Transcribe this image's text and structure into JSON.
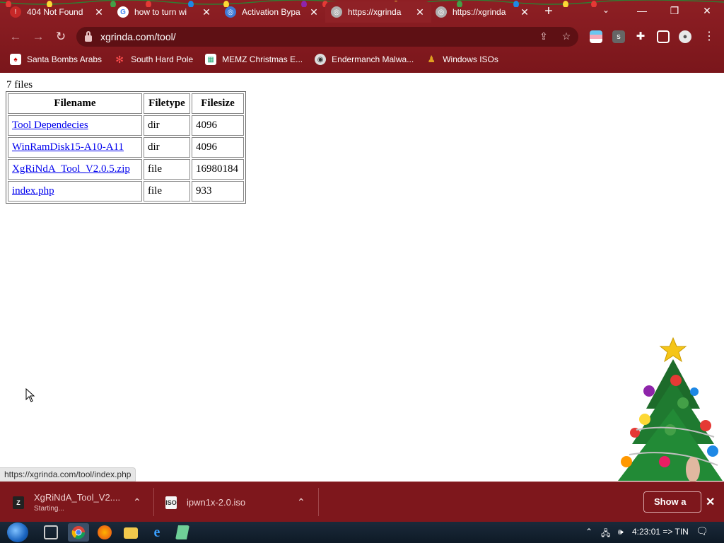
{
  "tabs": [
    {
      "title": "404 Not Found",
      "favicon": "error-favicon",
      "active": false
    },
    {
      "title": "how to turn wi",
      "favicon": "google-favicon",
      "active": false
    },
    {
      "title": "Activation Bypa",
      "favicon": "globe-favicon",
      "active": false
    },
    {
      "title": "https://xgrinda",
      "favicon": "globe-favicon",
      "active": true
    },
    {
      "title": "https://xgrinda",
      "favicon": "globe-favicon",
      "active": false
    }
  ],
  "address": {
    "url": "xgrinda.com/tool/"
  },
  "bookmarks": [
    {
      "label": "Santa Bombs Arabs",
      "icon": "santa-icon"
    },
    {
      "label": "South Hard Pole",
      "icon": "snowflake-icon"
    },
    {
      "label": "MEMZ Christmas E...",
      "icon": "gift-icon"
    },
    {
      "label": "Endermanch Malwa...",
      "icon": "raccoon-icon"
    },
    {
      "label": "Windows ISOs",
      "icon": "folder-icon"
    }
  ],
  "listing": {
    "count_label": "7 files",
    "headers": [
      "Filename",
      "Filetype",
      "Filesize"
    ],
    "rows": [
      {
        "name": "Tool Dependecies",
        "type": "dir",
        "size": "4096"
      },
      {
        "name": "WinRamDisk15-A10-A11",
        "type": "dir",
        "size": "4096"
      },
      {
        "name": "XgRiNdA_Tool_V2.0.5.zip",
        "type": "file",
        "size": "16980184"
      },
      {
        "name": "index.php",
        "type": "file",
        "size": "933"
      }
    ]
  },
  "statusbar": {
    "text": "https://xgrinda.com/tool/index.php"
  },
  "downloads": [
    {
      "name": "XgRiNdA_Tool_V2....",
      "status": "Starting..."
    },
    {
      "name": "ipwn1x-2.0.iso",
      "status": ""
    }
  ],
  "shelf": {
    "show_all_label": "Show a"
  },
  "taskbar": {
    "clock": "4:23:01 => TIN"
  },
  "colors": {
    "chrome": "#8e1f24",
    "shelf": "#7e171c",
    "link": "#0000ee"
  }
}
